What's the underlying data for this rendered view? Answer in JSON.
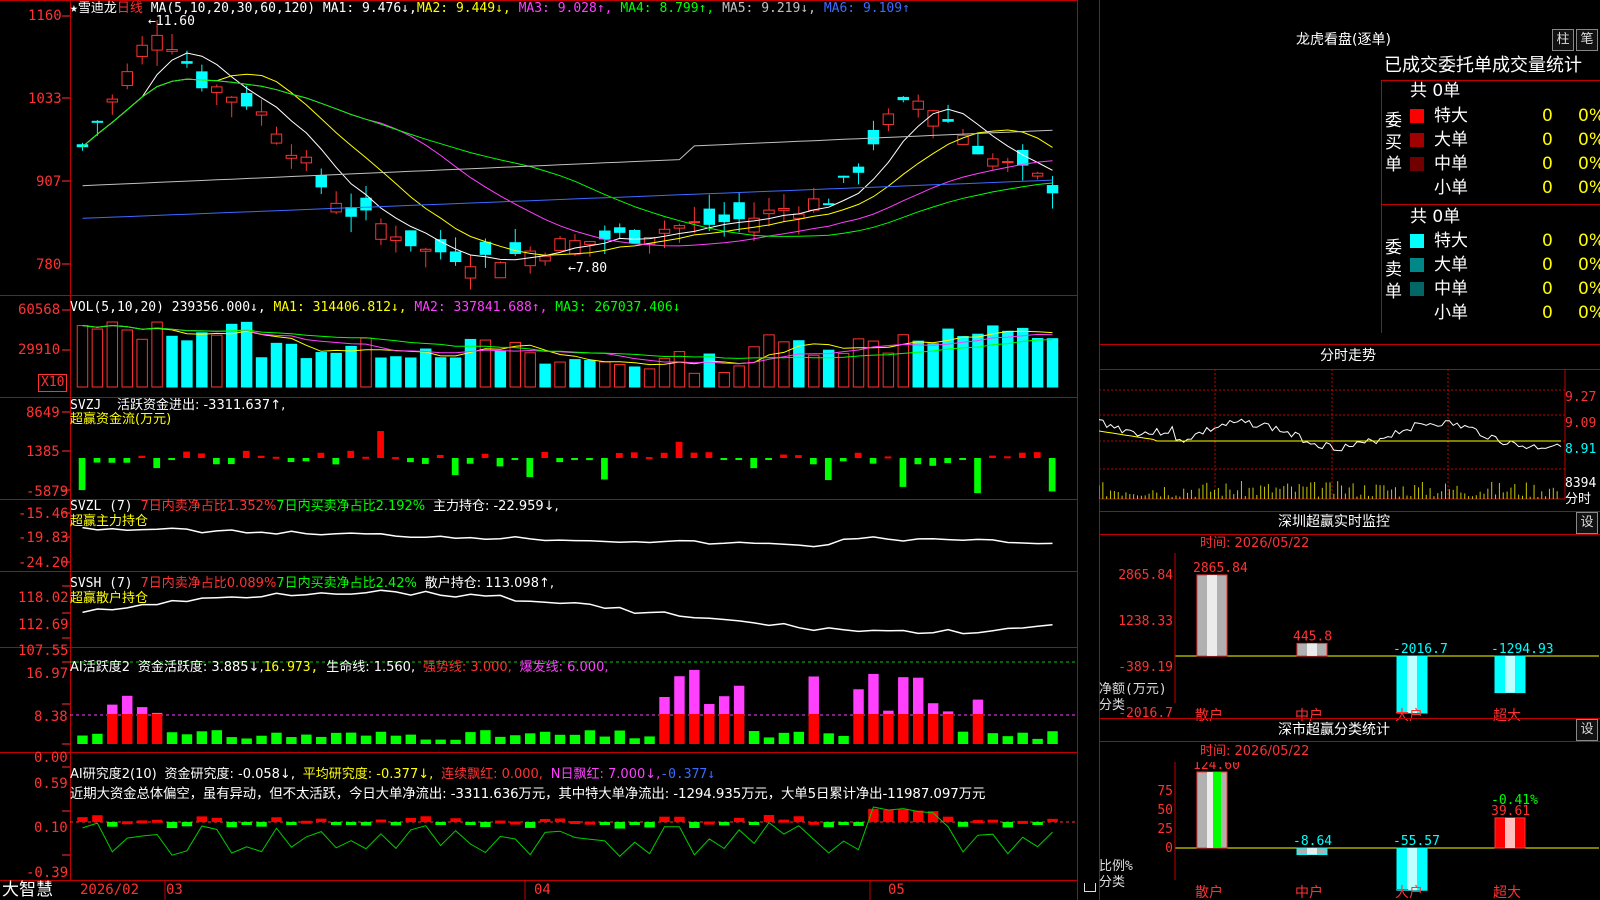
{
  "stock": {
    "name": "雪迪龙",
    "period": "日线",
    "ma_label": "MA(5,10,20,30,60,120)",
    "ma1": "MA1: 9.476↓,",
    "ma2": "MA2: 9.449↓,",
    "ma3": "MA3: 9.028↑,",
    "ma4": "MA4: 8.799↑,",
    "ma5": "MA5: 9.219↓,",
    "ma6": "MA6: 9.109↑",
    "high_mark": "11.60",
    "low_mark": "7.80",
    "y_ticks": [
      "1160",
      "1033",
      "907",
      "780"
    ]
  },
  "vol": {
    "label": "VOL(5,10,20)",
    "val": "239356.000↓,",
    "ma1": "MA1: 314406.812↓,",
    "ma2": "MA2: 337841.688↑,",
    "ma3": "MA3: 267037.406↓",
    "y_ticks": [
      "60568",
      "29910"
    ],
    "unit": "X10"
  },
  "svzj": {
    "label": "SVZJ",
    "text": "活跃资金进出: -3311.637↑,",
    "subtitle": "超赢资金流(万元)",
    "y_ticks": [
      "8649",
      "1385",
      "-5879"
    ]
  },
  "svzl": {
    "label": "SVZL (7)",
    "t1": "7日内卖净占比1.352%",
    "t2": "7日内买卖净占比2.192%",
    "t3": "主力持仓: -22.959↓,",
    "subtitle": "超赢主力持仓",
    "y_ticks": [
      "-15.46",
      "-19.83",
      "-24.20"
    ]
  },
  "svsh": {
    "label": "SVSH (7)",
    "t1": "7日内卖净占比0.089%",
    "t2": "7日内买卖净占比2.42%",
    "t3": "散户持仓: 113.098↑,",
    "subtitle": "超赢散户持仓",
    "y_ticks": [
      "118.02",
      "112.69",
      "107.55"
    ]
  },
  "ai1": {
    "label": "AI活跃度2",
    "t1": "资金活跃度: 3.885↓,",
    "t2": "16.973,",
    "t3": "生命线: 1.560,",
    "t4": "强势线: 3.000,",
    "t5": "爆发线: 6.000,",
    "y_ticks": [
      "16.97",
      "8.38",
      "0.00"
    ]
  },
  "ai2": {
    "label": "AI研究度2(10)",
    "t1": "资金研究度: -0.058↓,",
    "t2": "平均研究度: -0.377↓,",
    "t3": "连续飘红: 0.000,",
    "t4": "N日飘红: 7.000↓,",
    "t5": "-0.377↓",
    "summary": "近期大资金总体偏空，虽有异动，但不太活跃，今日大单净流出: -3311.636万元，其中特大单净流出: -1294.935万元，大单5日累计净出-11987.097万元",
    "y_ticks": [
      "0.59",
      "0.10",
      "-0.39"
    ]
  },
  "xaxis": {
    "year": "2026/02",
    "months": [
      "03",
      "04",
      "05"
    ],
    "brand": "大智慧"
  },
  "right": {
    "title": "龙虎看盘(逐单)",
    "btn1": "柱",
    "btn2": "笔",
    "stats_title": "已成交委托单成交量统计",
    "buy_total": "共 0单",
    "buy_label": "委买单",
    "sell_total": "共 0单",
    "sell_label": "委卖单",
    "rows": [
      {
        "name": "特大",
        "n": "0",
        "p": "0%"
      },
      {
        "name": "大单",
        "n": "0",
        "p": "0%"
      },
      {
        "name": "中单",
        "n": "0",
        "p": "0%"
      },
      {
        "name": "小单",
        "n": "0",
        "p": "0%"
      }
    ],
    "rows_sell": [
      {
        "name": "特大",
        "n": "0",
        "p": "0%"
      },
      {
        "name": "大单",
        "n": "0",
        "p": "0%"
      },
      {
        "name": "中单",
        "n": "0",
        "p": "0%"
      },
      {
        "name": "小单",
        "n": "0",
        "p": "0%"
      }
    ],
    "intraday_title": "分时走势",
    "intraday_ticks": [
      "9.27",
      "9.09",
      "8.91",
      "8394",
      "分时"
    ],
    "sz_title": "深圳超赢实时监控",
    "sz_btn": "设",
    "sz_time": "时间: 2026/05/22",
    "sz_yticks": [
      "2865.84",
      "1238.33",
      "-389.19",
      "-2016.7"
    ],
    "sz_ylabel": "净额(万元)",
    "sz_xlabel": "分类",
    "sz_cats": [
      "散户",
      "中户",
      "大户",
      "超大"
    ],
    "sz_vals": [
      "2865.84",
      "445.8",
      "-2016.7",
      "-1294.93"
    ],
    "sc_title": "深市超赢分类统计",
    "sc_btn": "设",
    "sc_time": "时间: 2026/05/22",
    "sc_yticks": [
      "75",
      "50",
      "25",
      "0"
    ],
    "sc_ylabel": "比例%",
    "sc_xlabel": "分类",
    "sc_cats": [
      "散户",
      "中户",
      "大户",
      "超大"
    ],
    "sc_vals": [
      "124.60",
      "-8.64",
      "-55.57",
      "39.61"
    ],
    "sc_top": "-0.41%"
  },
  "chart_data": [
    {
      "type": "bar",
      "title": "深圳超赢实时监控",
      "ylabel": "净额(万元)",
      "categories": [
        "散户",
        "中户",
        "大户",
        "超大"
      ],
      "values": [
        2865.84,
        445.8,
        -2016.7,
        -1294.93
      ],
      "ylim": [
        -2016.7,
        2865.84
      ]
    },
    {
      "type": "bar",
      "title": "深市超赢分类统计",
      "ylabel": "比例%",
      "categories": [
        "散户",
        "中户",
        "大户",
        "超大"
      ],
      "values": [
        124.6,
        -8.64,
        -55.57,
        39.61
      ],
      "ylim": [
        0,
        75
      ]
    }
  ],
  "colors": {
    "up": "#ff3232",
    "down": "#00ffff",
    "grid": "#c00000",
    "bg": "#000000"
  }
}
